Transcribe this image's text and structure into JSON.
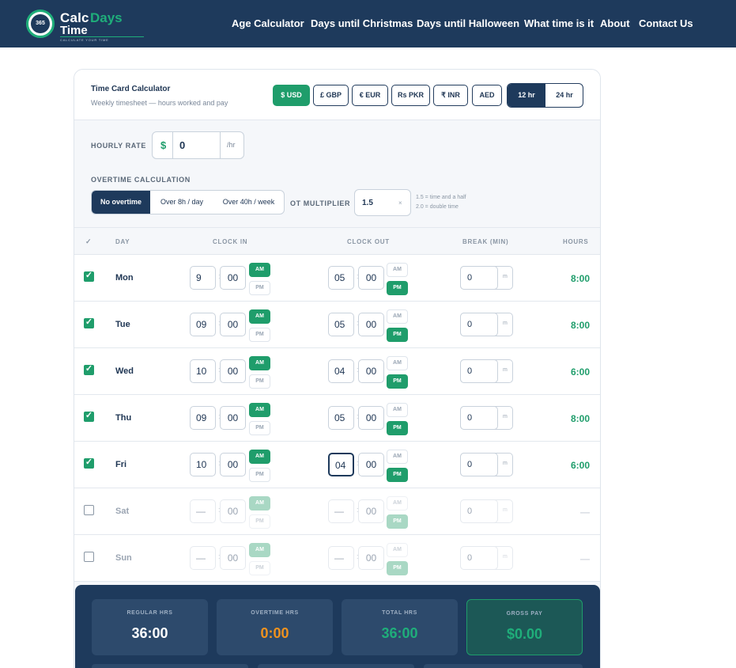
{
  "header": {
    "logo": {
      "badge": "365",
      "word1": "Calc",
      "word2": "Days",
      "word3": "Time",
      "tagline": "CALCULATE YOUR TIME"
    },
    "nav": [
      "Age Calculator",
      "Days until Christmas",
      "Days until Halloween",
      "What time is it",
      "About",
      "Contact Us"
    ]
  },
  "calculator": {
    "title": "Time Card Calculator",
    "subtitle": "Weekly timesheet — hours worked and pay",
    "currencies": [
      "$ USD",
      "£ GBP",
      "€ EUR",
      "Rs PKR",
      "₹ INR",
      "AED"
    ],
    "active_currency": "$ USD",
    "time_formats": [
      "12 hr",
      "24 hr"
    ],
    "active_format": "12 hr",
    "hourly_rate": {
      "label": "HOURLY RATE",
      "symbol": "$",
      "value": "0",
      "unit": "/hr"
    },
    "overtime": {
      "label": "OVERTIME CALCULATION",
      "options": [
        "No overtime",
        "Over 8h / day",
        "Over 40h / week"
      ],
      "active": "No overtime",
      "multiplier_label": "OT MULTIPLIER",
      "multiplier_value": "1.5",
      "clear_glyph": "×",
      "hints": [
        "1.5 = time and a half",
        "2.0 = double time"
      ]
    },
    "table": {
      "headers": {
        "check": "✓",
        "day": "DAY",
        "clock_in": "CLOCK IN",
        "clock_out": "CLOCK OUT",
        "break": "BREAK (MIN)",
        "hours": "HOURS"
      },
      "am_label": "AM",
      "pm_label": "PM",
      "break_unit": "m",
      "rows": [
        {
          "day": "Mon",
          "checked": true,
          "in_h": "9",
          "in_m": "00",
          "in_ampm": "AM",
          "out_h": "05",
          "out_m": "00",
          "out_ampm": "PM",
          "break": "0",
          "hours": "8:00"
        },
        {
          "day": "Tue",
          "checked": true,
          "in_h": "09",
          "in_m": "00",
          "in_ampm": "AM",
          "out_h": "05",
          "out_m": "00",
          "out_ampm": "PM",
          "break": "0",
          "hours": "8:00"
        },
        {
          "day": "Wed",
          "checked": true,
          "in_h": "10",
          "in_m": "00",
          "in_ampm": "AM",
          "out_h": "04",
          "out_m": "00",
          "out_ampm": "PM",
          "break": "0",
          "hours": "6:00"
        },
        {
          "day": "Thu",
          "checked": true,
          "in_h": "09",
          "in_m": "00",
          "in_ampm": "AM",
          "out_h": "05",
          "out_m": "00",
          "out_ampm": "PM",
          "break": "0",
          "hours": "8:00"
        },
        {
          "day": "Fri",
          "checked": true,
          "in_h": "10",
          "in_m": "00",
          "in_ampm": "AM",
          "out_h": "04",
          "out_m": "00",
          "out_ampm": "PM",
          "break": "0",
          "hours": "6:00"
        },
        {
          "day": "Sat",
          "checked": false,
          "in_h": "—",
          "in_m": "00",
          "in_ampm": "AM",
          "out_h": "—",
          "out_m": "00",
          "out_ampm": "PM",
          "break": "0",
          "hours": "—"
        },
        {
          "day": "Sun",
          "checked": false,
          "in_h": "—",
          "in_m": "00",
          "in_ampm": "AM",
          "out_h": "—",
          "out_m": "00",
          "out_ampm": "PM",
          "break": "0",
          "hours": "—"
        }
      ]
    },
    "summary": [
      {
        "label": "REGULAR HRS",
        "value": "36:00",
        "color": "#ffffff"
      },
      {
        "label": "OVERTIME HRS",
        "value": "0:00",
        "color": "#f0921e"
      },
      {
        "label": "TOTAL HRS",
        "value": "36:00",
        "color": "#1fae7a"
      },
      {
        "label": "GROSS PAY",
        "value": "$0.00",
        "color": "#1fae7a"
      }
    ]
  }
}
